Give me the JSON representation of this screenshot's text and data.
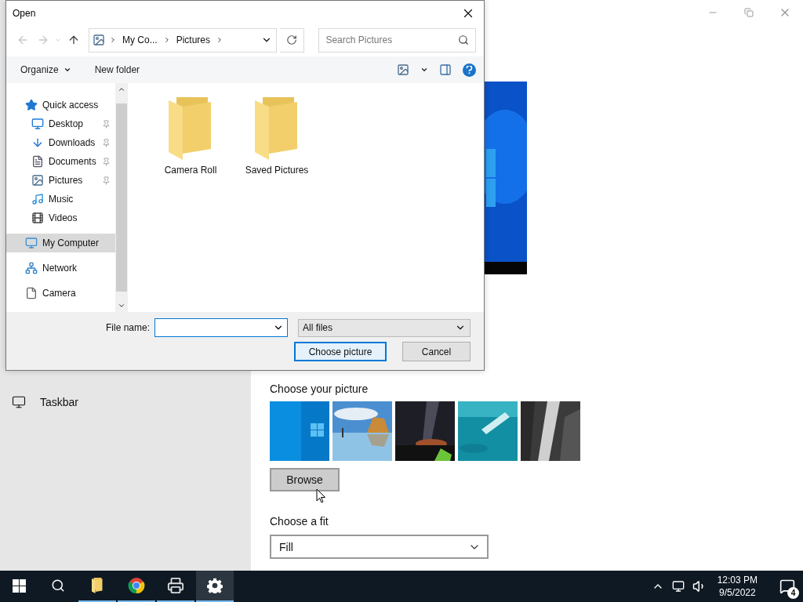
{
  "settings": {
    "sidebar": {
      "items": [
        {
          "label": "Taskbar",
          "selected": false
        }
      ]
    },
    "background": {
      "heading": "Choose your picture",
      "browse": "Browse"
    },
    "fit": {
      "heading": "Choose a fit",
      "value": "Fill"
    }
  },
  "dialog": {
    "title": "Open",
    "nav_buttons": [
      {
        "disabled": true
      },
      {
        "disabled": true
      },
      {
        "disabled": false
      }
    ],
    "address": {
      "crumbs": [
        "My Co...",
        "Pictures"
      ]
    },
    "search": {
      "placeholder": "Search Pictures"
    },
    "toolbar": {
      "organize": "Organize",
      "new_folder": "New folder"
    },
    "nav": {
      "items": [
        {
          "label": "Quick access",
          "selected": false,
          "children": [
            {
              "label": "Desktop",
              "pinned": true,
              "selected": false
            },
            {
              "label": "Downloads",
              "pinned": true,
              "selected": false
            },
            {
              "label": "Documents",
              "pinned": true,
              "selected": false
            },
            {
              "label": "Pictures",
              "pinned": true,
              "selected": false
            },
            {
              "label": "Music",
              "pinned": false,
              "selected": false
            },
            {
              "label": "Videos",
              "pinned": false,
              "selected": false
            }
          ]
        },
        {
          "label": "My Computer",
          "selected": true
        },
        {
          "label": "Network",
          "selected": false
        },
        {
          "label": "Camera",
          "selected": false
        }
      ]
    },
    "files": [
      {
        "name": "Camera Roll"
      },
      {
        "name": "Saved Pictures"
      }
    ],
    "file_name": {
      "label": "File name:"
    },
    "filter": "All files",
    "buttons": [
      {
        "label": "Choose picture",
        "default": true
      },
      {
        "label": "Cancel",
        "default": false
      }
    ]
  },
  "taskbar": {
    "apps": [
      {
        "running": true,
        "selected": false
      },
      {
        "running": true,
        "selected": false
      },
      {
        "running": true,
        "selected": false
      },
      {
        "running": true,
        "selected": true
      }
    ],
    "clock": {
      "time": "12:03 PM",
      "date": "9/5/2022"
    },
    "notifications": "4"
  }
}
